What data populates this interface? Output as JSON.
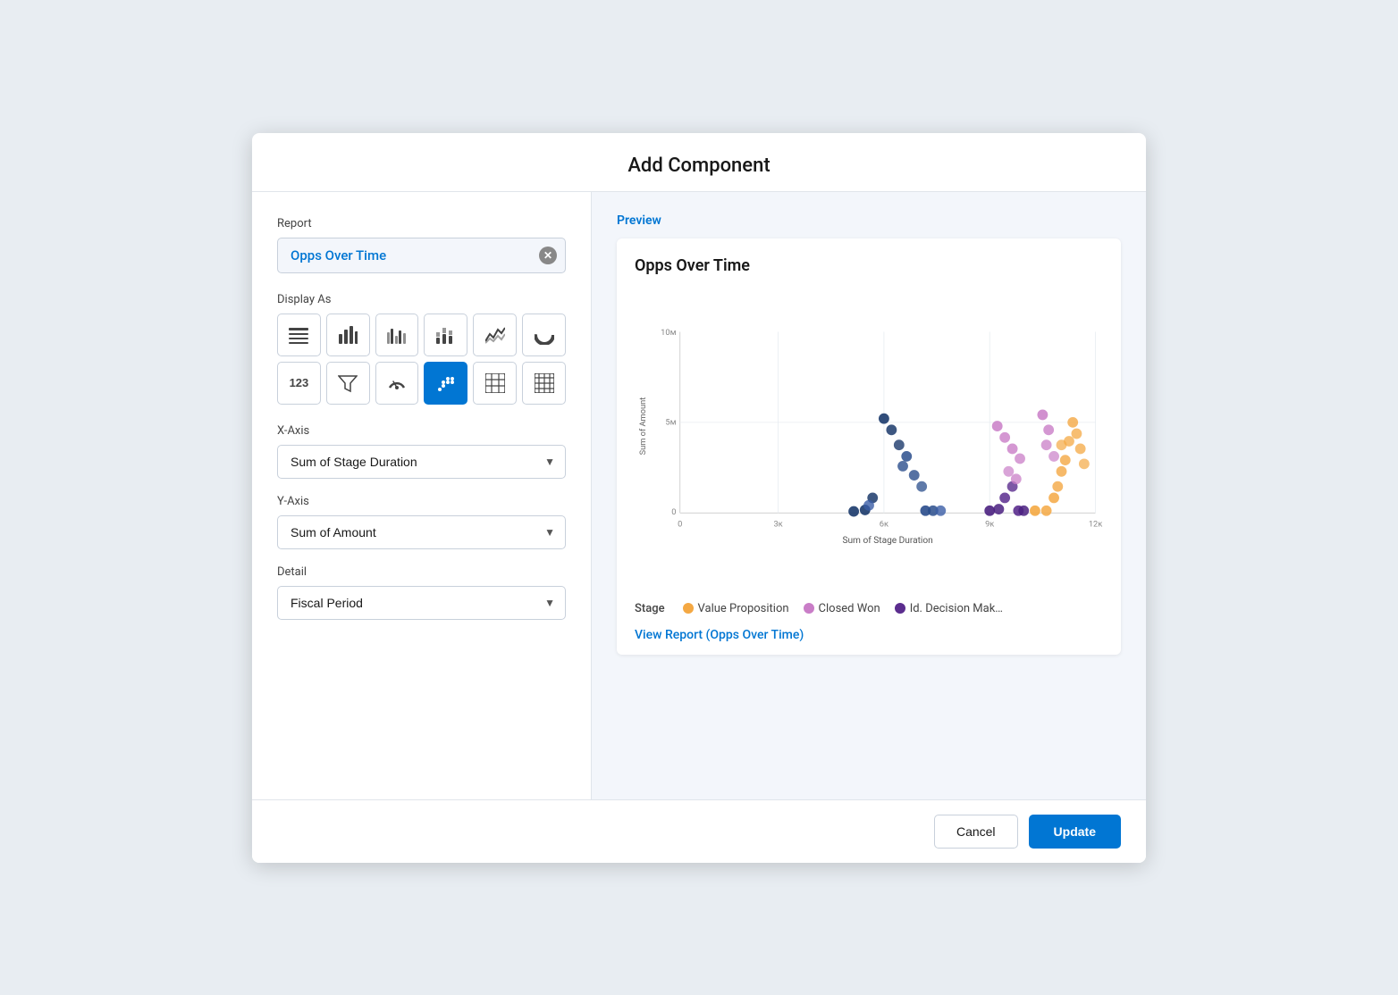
{
  "dialog": {
    "title": "Add Component"
  },
  "left": {
    "report_label": "Report",
    "report_value": "Opps Over Time",
    "display_as_label": "Display As",
    "chart_types": [
      {
        "id": "table",
        "icon": "≡",
        "label": "Table",
        "active": false
      },
      {
        "id": "bar",
        "icon": "bar",
        "label": "Bar Chart",
        "active": false
      },
      {
        "id": "grouped-bar",
        "icon": "grouped-bar",
        "label": "Grouped Bar",
        "active": false
      },
      {
        "id": "stacked-bar",
        "icon": "stacked-bar",
        "label": "Stacked Bar",
        "active": false
      },
      {
        "id": "line",
        "icon": "line",
        "label": "Line Chart",
        "active": false
      },
      {
        "id": "donut",
        "icon": "donut",
        "label": "Donut Chart",
        "active": false
      },
      {
        "id": "number",
        "icon": "123",
        "label": "Metric",
        "active": false
      },
      {
        "id": "funnel",
        "icon": "funnel",
        "label": "Funnel",
        "active": false
      },
      {
        "id": "gauge",
        "icon": "gauge",
        "label": "Gauge",
        "active": false
      },
      {
        "id": "scatter",
        "icon": "scatter",
        "label": "Scatter Chart",
        "active": true
      },
      {
        "id": "data-table",
        "icon": "data-table",
        "label": "Data Table",
        "active": false
      },
      {
        "id": "matrix",
        "icon": "matrix",
        "label": "Matrix",
        "active": false
      }
    ],
    "xaxis_label": "X-Axis",
    "xaxis_value": "Sum of Stage Duration",
    "yaxis_label": "Y-Axis",
    "yaxis_value": "Sum of Amount",
    "detail_label": "Detail",
    "detail_value": "Fiscal Period"
  },
  "right": {
    "preview_label": "Preview",
    "chart_title": "Opps Over Time",
    "xaxis_title": "Sum of Stage Duration",
    "yaxis_title": "Sum of Amount",
    "legend_stage_label": "Stage",
    "legend_items": [
      {
        "label": "Value Proposition",
        "color": "#f4a843"
      },
      {
        "label": "Closed Won",
        "color": "#c97dc7"
      },
      {
        "label": "Id. Decision Mak…",
        "color": "#5b2d8e"
      }
    ],
    "view_report_link": "View Report (Opps Over Time)"
  },
  "footer": {
    "cancel_label": "Cancel",
    "update_label": "Update"
  }
}
